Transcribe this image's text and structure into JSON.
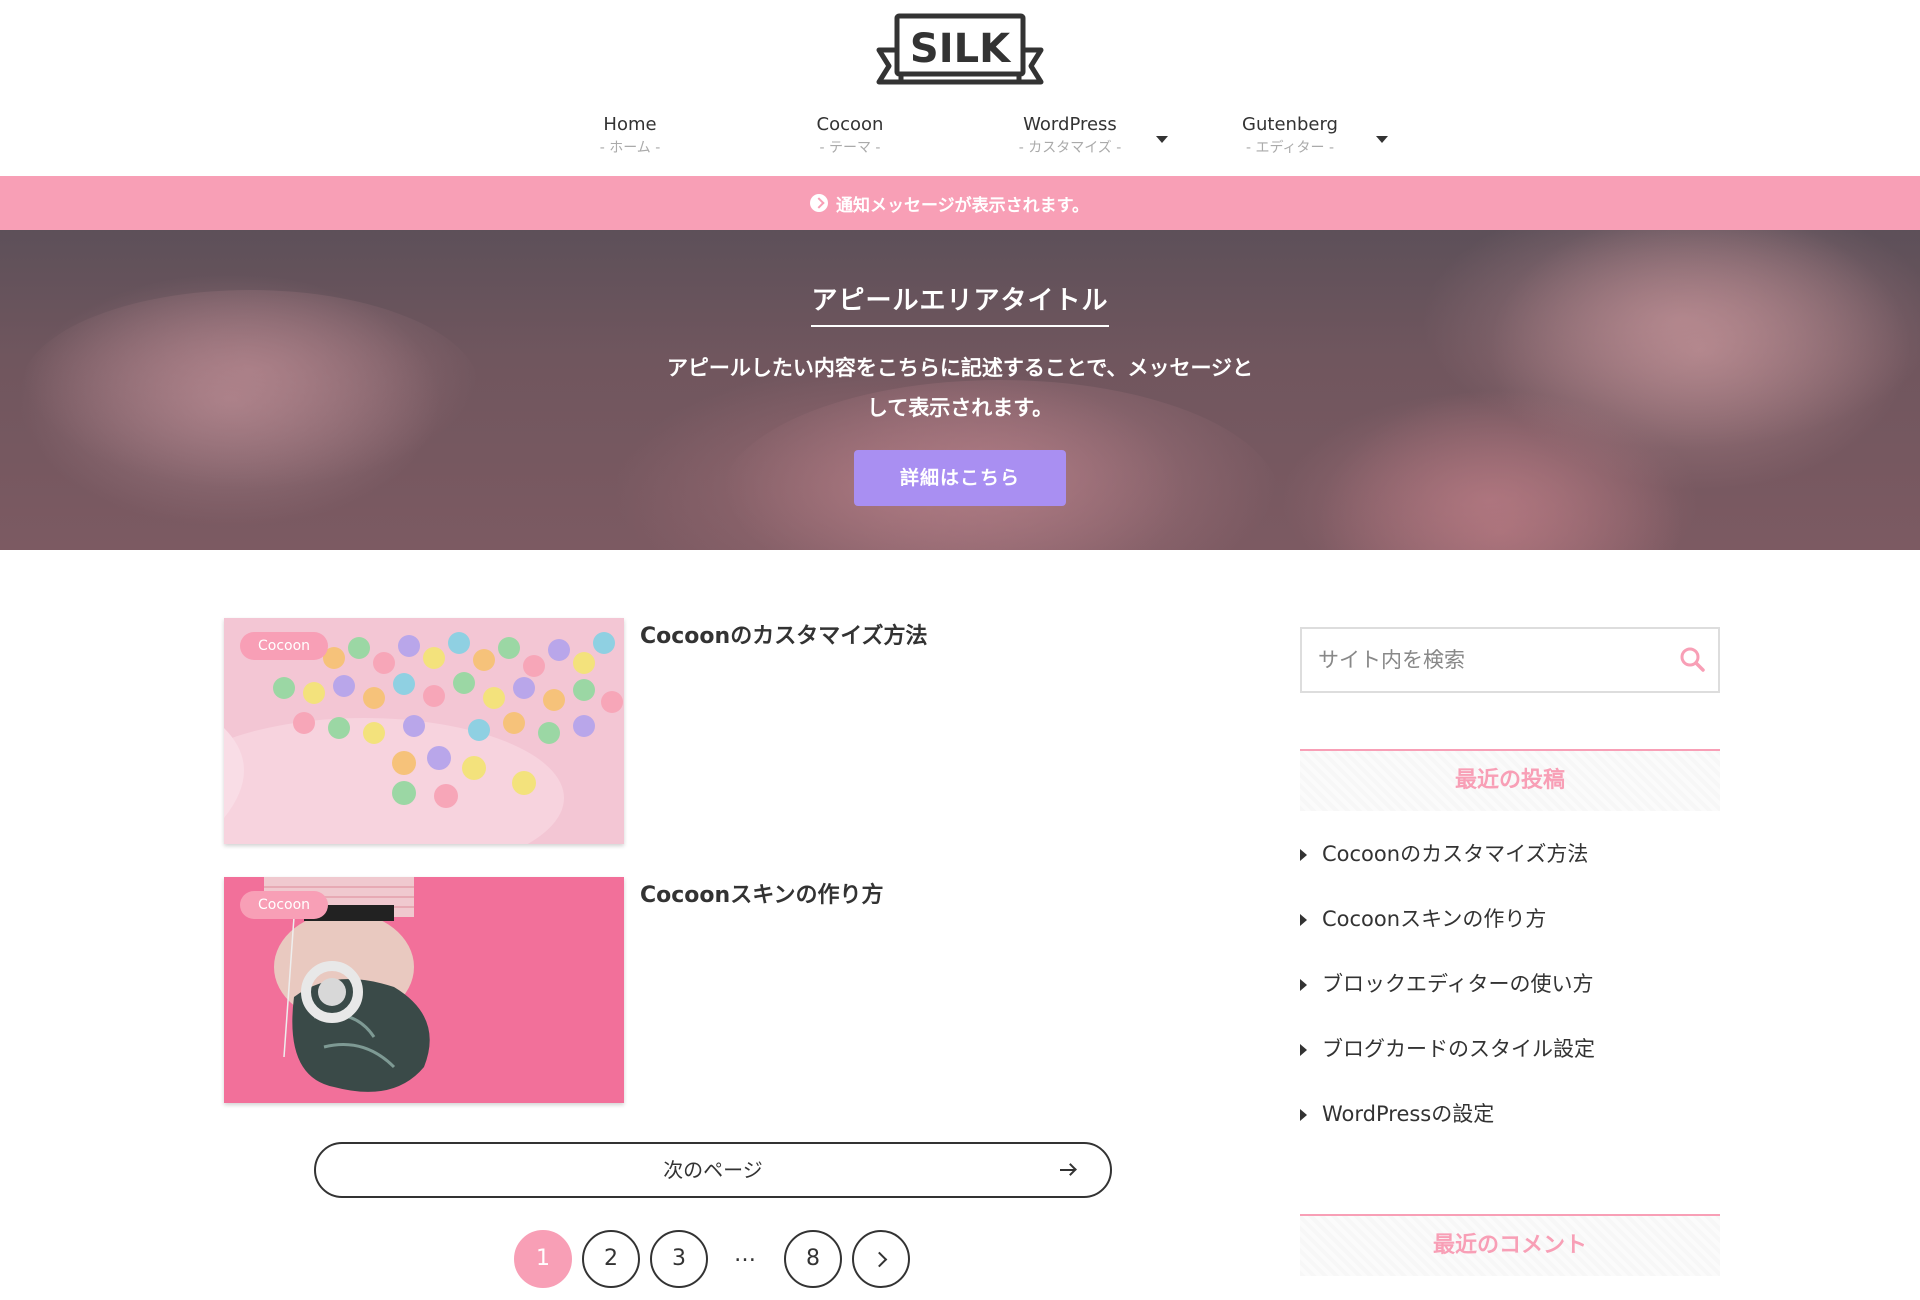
{
  "site": {
    "logo_text": "SILK"
  },
  "nav": {
    "items": [
      {
        "label": "Home",
        "sub": "- ホーム -"
      },
      {
        "label": "Cocoon",
        "sub": "- テーマ -"
      },
      {
        "label": "WordPress",
        "sub": "- カスタマイズ -"
      },
      {
        "label": "Gutenberg",
        "sub": "- エディター -"
      }
    ]
  },
  "notice": {
    "text": "通知メッセージが表示されます。",
    "icon": "arrow-circle-right-icon"
  },
  "appeal": {
    "title": "アピールエリアタイトル",
    "message_line1": "アピールしたい内容をこちらに記述することで、メッセージと",
    "message_line2": "して表示されます。",
    "button_label": "詳細はこちら"
  },
  "posts": [
    {
      "category": "Cocoon",
      "title": "Cocoonのカスタマイズ方法"
    },
    {
      "category": "Cocoon",
      "title": "Cocoonスキンの作り方"
    }
  ],
  "pagination": {
    "next_label": "次のページ",
    "pages": [
      "1",
      "2",
      "3",
      "8"
    ],
    "current": "1",
    "ellipsis": "…"
  },
  "sidebar": {
    "search_placeholder": "サイト内を検索",
    "recent_posts_title": "最近の投稿",
    "recent_posts": [
      "Cocoonのカスタマイズ方法",
      "Cocoonスキンの作り方",
      "ブロックエディターの使い方",
      "ブログカードのスタイル設定",
      "WordPressの設定"
    ],
    "recent_comments_title": "最近のコメント"
  },
  "colors": {
    "accent_pink": "#f89fb6",
    "button_purple": "#a98ff2",
    "text_dark": "#333333"
  }
}
